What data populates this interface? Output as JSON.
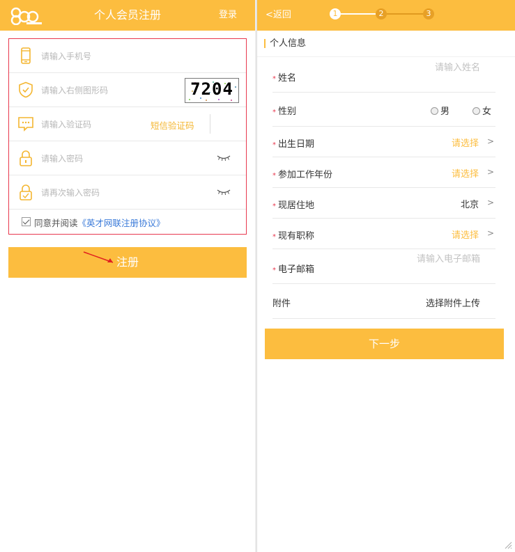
{
  "register": {
    "title": "个人会员注册",
    "login": "登录",
    "phone_placeholder": "请输入手机号",
    "captcha_placeholder": "请输入右侧图形码",
    "captcha_text": "7204",
    "sms_placeholder": "请输入验证码",
    "sms_button": "短信验证码",
    "password_placeholder": "请输入密码",
    "password2_placeholder": "请再次输入密码",
    "agree_text": "同意并阅读",
    "agree_link": "《英才网联注册协议》",
    "submit": "注册",
    "icons": [
      "phone-icon",
      "shield-check-icon",
      "chat-icon",
      "lock-icon",
      "lock-check-icon",
      "eye-closed-icon"
    ]
  },
  "profile": {
    "back": "<返回",
    "steps": [
      "1",
      "2",
      "3"
    ],
    "section_title": "个人信息",
    "required_mark": "*",
    "fields": {
      "name_label": "姓名",
      "name_placeholder": "请输入姓名",
      "gender_label": "性别",
      "gender_male": "男",
      "gender_female": "女",
      "birth_label": "出生日期",
      "birth_value": "请选择",
      "work_year_label": "参加工作年份",
      "work_year_value": "请选择",
      "residence_label": "现居住地",
      "residence_value": "北京",
      "title_label": "现有职称",
      "title_value": "请选择",
      "email_label": "电子邮箱",
      "email_placeholder": "请输入电子邮箱",
      "attachment_label": "附件",
      "attachment_value": "选择附件上传"
    },
    "chevron": ">",
    "next": "下一步"
  },
  "colors": {
    "accent": "#fcbd3f",
    "error_border": "#e8384e",
    "link": "#3a7ad9",
    "placeholder": "#b8b8b8"
  }
}
